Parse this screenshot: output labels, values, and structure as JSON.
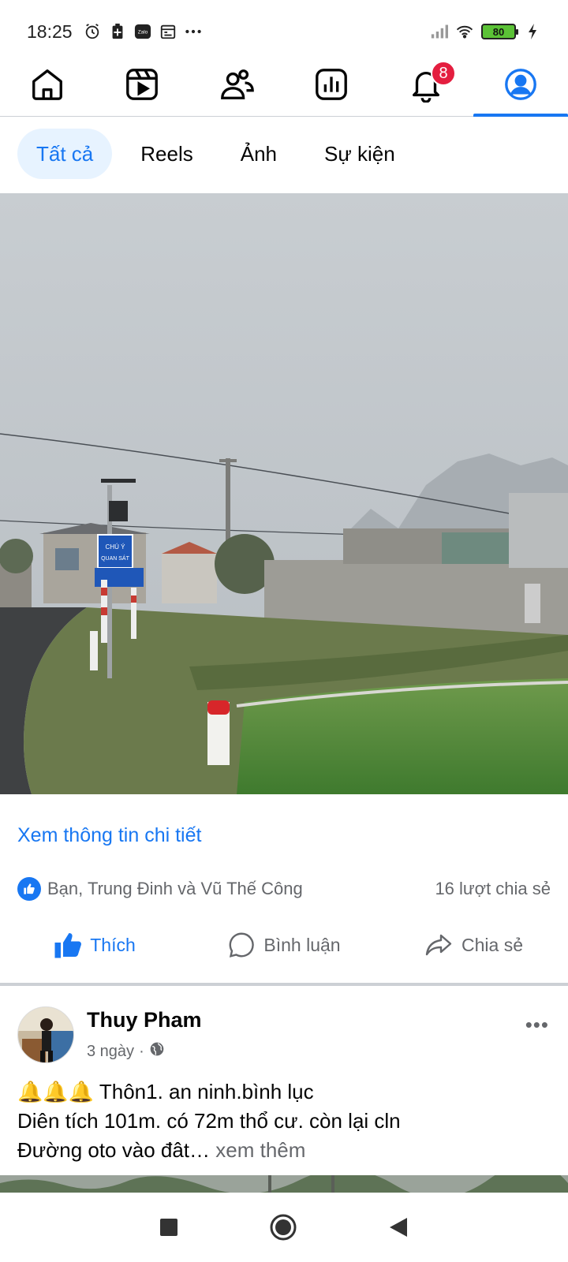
{
  "status_bar": {
    "time": "18:25",
    "battery": "80",
    "icons": [
      "alarm-icon",
      "battery-saver-icon",
      "zalo-icon",
      "calendar-icon",
      "more-icon",
      "signal-icon",
      "wifi-icon",
      "charging-icon"
    ]
  },
  "top_nav": {
    "items": [
      "home-icon",
      "reels-icon",
      "friends-icon",
      "dashboard-icon",
      "notifications-icon",
      "profile-icon"
    ],
    "active": "profile-icon",
    "notification_count": "8"
  },
  "filters": {
    "chips": [
      "Tất cả",
      "Reels",
      "Ảnh",
      "Sự kiện"
    ],
    "active": "Tất cả"
  },
  "post1": {
    "details_link": "Xem thông tin chi tiết",
    "reactions_text": "Bạn, Trung Đinh và Vũ Thế Công",
    "shares_text": "16 lượt chia sẻ",
    "actions": {
      "like": "Thích",
      "comment": "Bình luận",
      "share": "Chia sẻ"
    },
    "sign_text": [
      "CHÚ Ý",
      "QUAN SÁT"
    ]
  },
  "post2": {
    "author": "Thuy Pham",
    "time": "3 ngày",
    "separator": "·",
    "more": "•••",
    "text_line1": "🔔🔔🔔 Thôn1. an ninh.bình lục",
    "text_line2": "Diên tích 101m. có 72m thổ cư. còn lại cln",
    "text_line3": "Đường oto vào đât…",
    "see_more": "xem thêm"
  },
  "colors": {
    "accent": "#1877f2",
    "badge": "#e41e3f",
    "secondary_text": "#65676b"
  }
}
